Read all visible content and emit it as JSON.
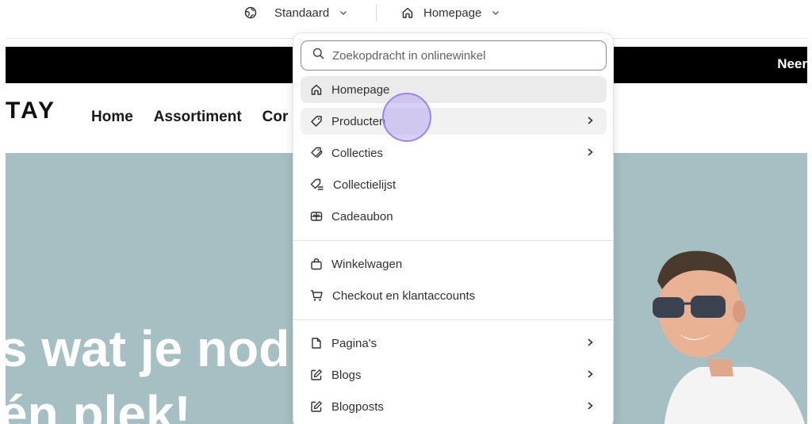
{
  "topbar": {
    "theme_label": "Standaard",
    "page_label": "Homepage"
  },
  "preview": {
    "announcement": "Neer",
    "logo": "TAY",
    "nav": [
      "Home",
      "Assortiment",
      "Cor"
    ],
    "hero_line1": "s wat je nod",
    "hero_line2": "én plek!"
  },
  "dropdown": {
    "search_placeholder": "Zoekopdracht in onlinewinkel",
    "items": [
      {
        "label": "Homepage",
        "icon": "home-icon"
      },
      {
        "label": "Producten",
        "icon": "tag-icon"
      },
      {
        "label": "Collecties",
        "icon": "tags-icon"
      },
      {
        "label": "Collectielijst",
        "icon": "tag-list-icon"
      },
      {
        "label": "Cadeaubon",
        "icon": "gift-card-icon"
      },
      {
        "label": "Winkelwagen",
        "icon": "bag-icon"
      },
      {
        "label": "Checkout en klantaccounts",
        "icon": "cart-icon"
      },
      {
        "label": "Pagina's",
        "icon": "page-icon"
      },
      {
        "label": "Blogs",
        "icon": "edit-icon"
      },
      {
        "label": "Blogposts",
        "icon": "edit-icon"
      }
    ]
  },
  "colors": {
    "hero_bg": "#a5bfc3",
    "announcement_bg": "#000000",
    "cursor": "#9a86e8"
  }
}
